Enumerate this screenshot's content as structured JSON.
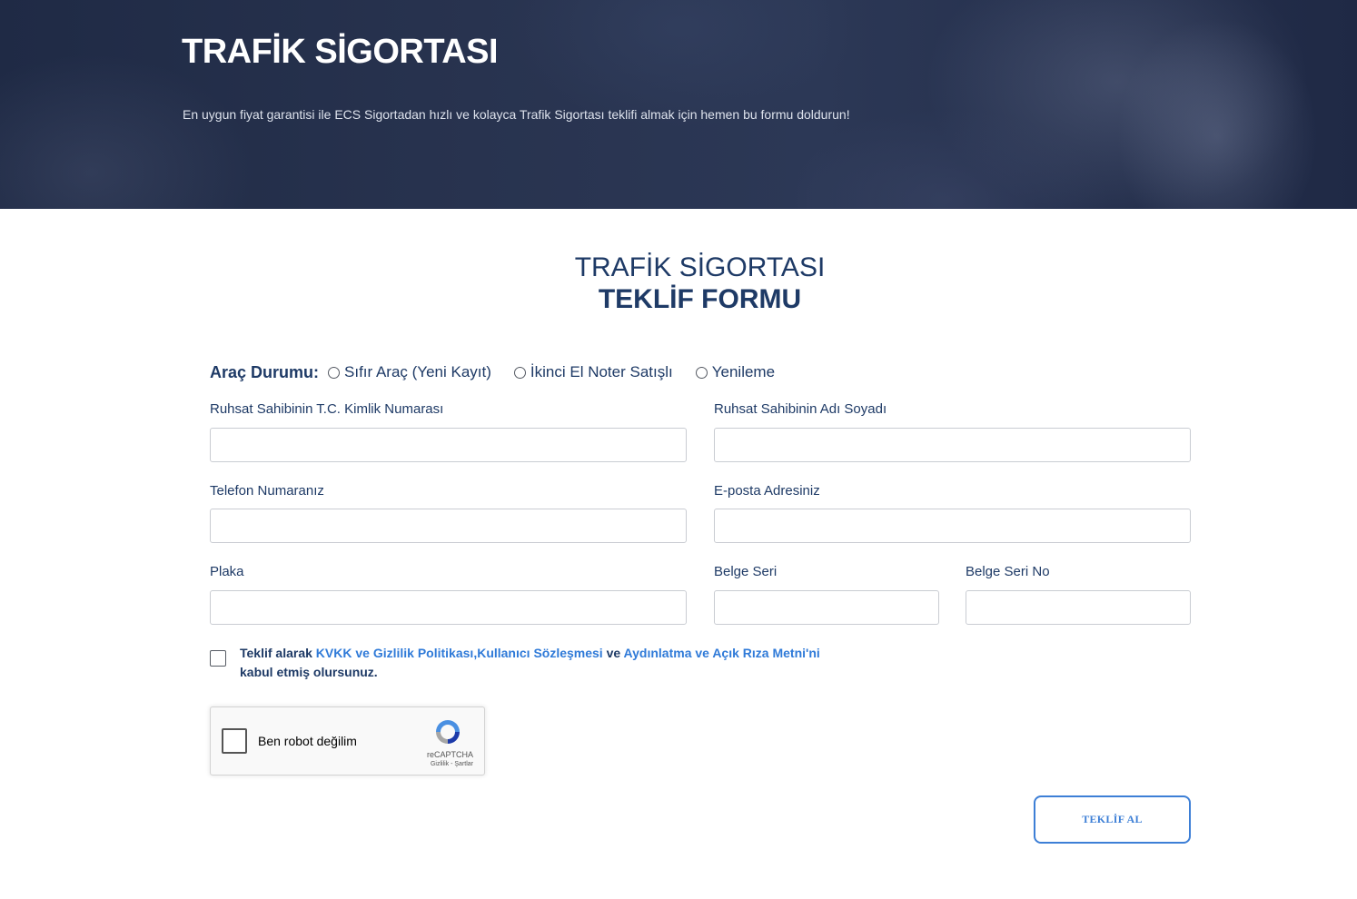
{
  "hero": {
    "title": "TRAFİK SİGORTASI",
    "subtitle": "En uygun fiyat garantisi ile ECS Sigortadan hızlı ve kolayca Trafik Sigortası teklifi almak için hemen bu formu doldurun!"
  },
  "form": {
    "heading_line1": "TRAFİK SİGORTASI",
    "heading_line2": "TEKLİF FORMU",
    "status_label": "Araç Durumu:",
    "status_options": [
      "Sıfır Araç (Yeni Kayıt)",
      "İkinci El Noter Satışlı",
      "Yenileme"
    ],
    "fields": {
      "tc": {
        "label": "Ruhsat Sahibinin T.C. Kimlik Numarası",
        "value": ""
      },
      "name": {
        "label": "Ruhsat Sahibinin Adı Soyadı",
        "value": ""
      },
      "phone": {
        "label": "Telefon Numaranız",
        "value": ""
      },
      "email": {
        "label": "E-posta Adresiniz",
        "value": ""
      },
      "plate": {
        "label": "Plaka",
        "value": ""
      },
      "doc_serial": {
        "label": "Belge Seri",
        "value": ""
      },
      "doc_serial_no": {
        "label": "Belge Seri No",
        "value": ""
      }
    },
    "consent": {
      "prefix": "Teklif alarak ",
      "link1": "KVKK ve Gizlilik Politikası",
      "comma": ",",
      "link2": "Kullanıcı Sözleşmesi",
      "middle": " ve ",
      "link3": "Aydınlatma ve Açık Rıza Metni'ni",
      "suffix": " kabul etmiş olursunuz."
    },
    "recaptcha": {
      "label": "Ben robot değilim",
      "brand": "reCAPTCHA",
      "terms": "Gizlilik - Şartlar"
    },
    "submit_label": "TEKLİF AL"
  },
  "colors": {
    "primary_text": "#1e3a66",
    "link": "#2f7ad8",
    "button_border": "#3d7fd6"
  }
}
